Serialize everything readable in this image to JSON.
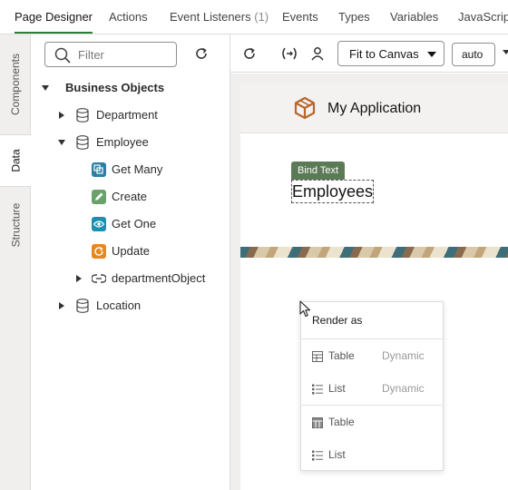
{
  "tabs": [
    {
      "label": "Page Designer",
      "count": ""
    },
    {
      "label": "Actions",
      "count": ""
    },
    {
      "label": "Event Listeners",
      "count": "(1)"
    },
    {
      "label": "Events",
      "count": ""
    },
    {
      "label": "Types",
      "count": ""
    },
    {
      "label": "Variables",
      "count": ""
    },
    {
      "label": "JavaScript",
      "count": ""
    }
  ],
  "rail": {
    "components": "Components",
    "data": "Data",
    "structure": "Structure"
  },
  "filter": {
    "placeholder": "Filter"
  },
  "tree": {
    "root": "Business Objects",
    "department": "Department",
    "employee": "Employee",
    "get_many": "Get Many",
    "create": "Create",
    "get_one": "Get One",
    "update": "Update",
    "department_object": "departmentObject",
    "location": "Location"
  },
  "toolbar": {
    "fit": "Fit to Canvas",
    "zoom": "auto"
  },
  "canvas": {
    "app_title": "My Application",
    "bind_tag": "Bind Text",
    "heading": "Employees"
  },
  "popup": {
    "title": "Render as",
    "items": [
      {
        "label": "Table",
        "sub": "Dynamic"
      },
      {
        "label": "List",
        "sub": "Dynamic"
      },
      {
        "label": "Table",
        "sub": ""
      },
      {
        "label": "List",
        "sub": ""
      }
    ]
  },
  "colors": {
    "accent_green": "#2e7d3c",
    "get_many": "#2b7fa3",
    "create": "#6aa36a",
    "get_one": "#1f8fb0",
    "update": "#e8871e",
    "bind_tag": "#5b7a56",
    "logo": "#b8662a"
  }
}
